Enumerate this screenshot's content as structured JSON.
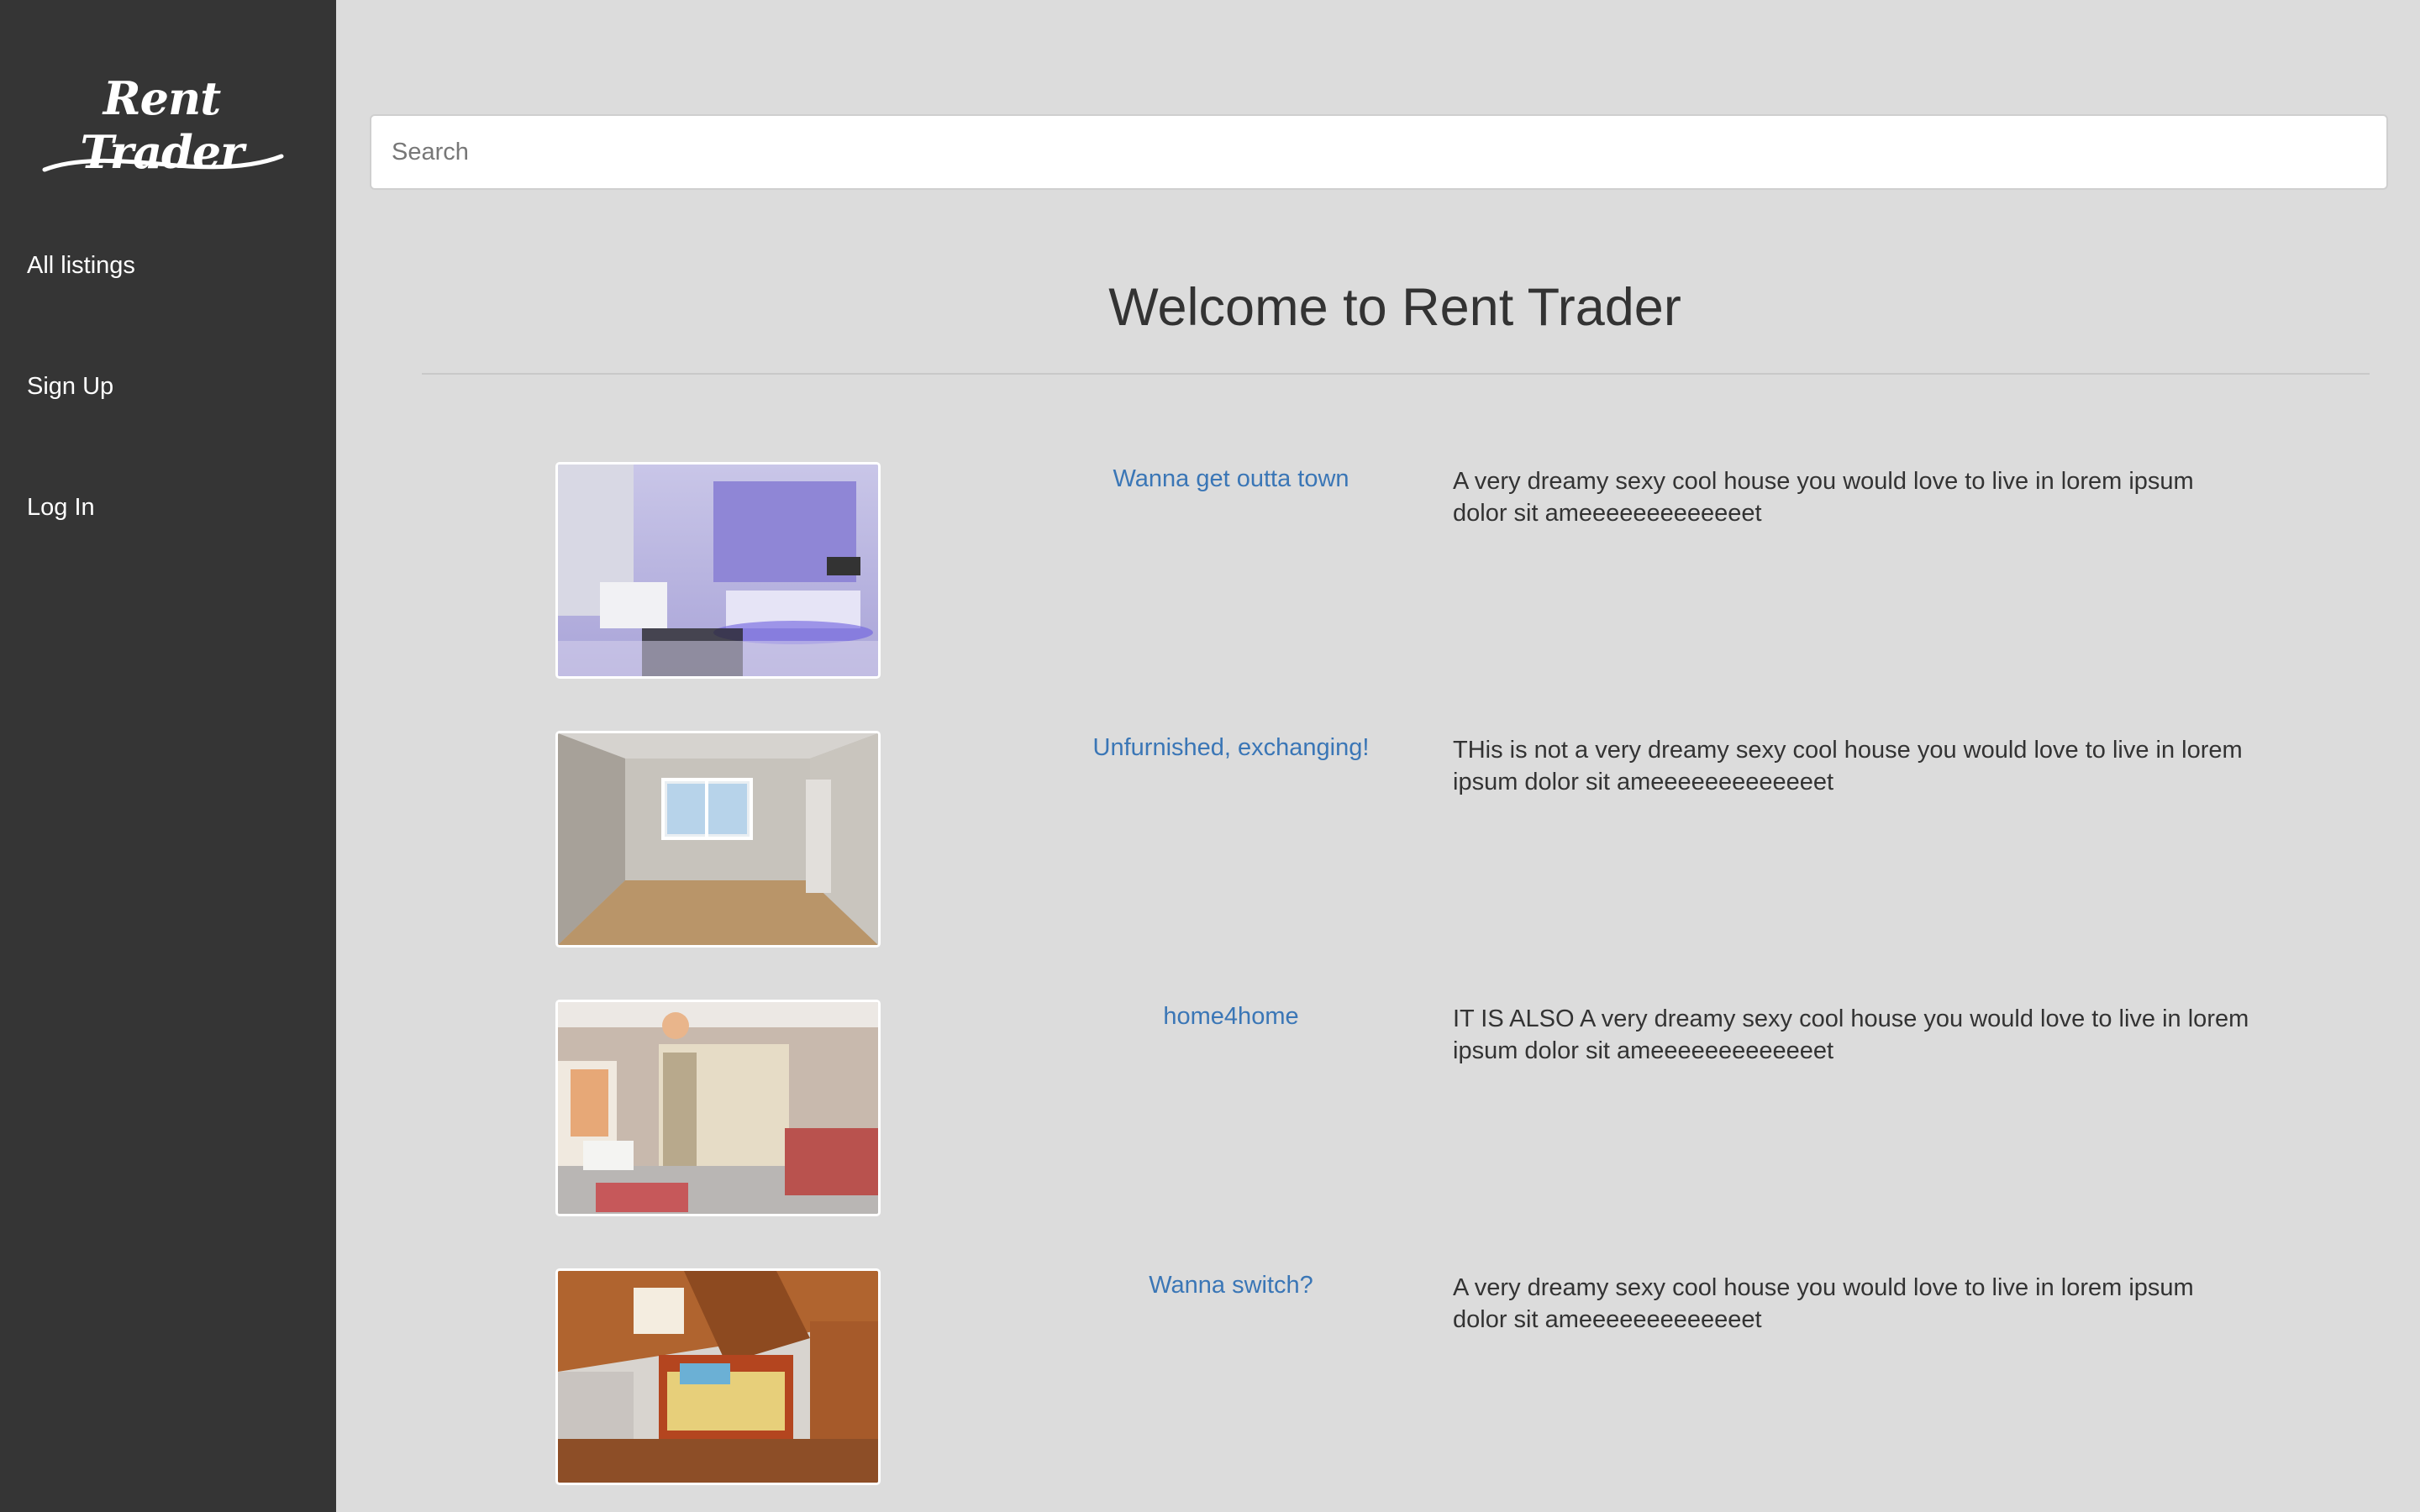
{
  "sidebar": {
    "logo_text": "Rent Trader",
    "nav": [
      {
        "label": "All listings"
      },
      {
        "label": "Sign Up"
      },
      {
        "label": "Log In"
      }
    ]
  },
  "search": {
    "placeholder": "Search",
    "value": ""
  },
  "main": {
    "title": "Welcome to Rent Trader"
  },
  "listings": [
    {
      "title": "Wanna get outta town",
      "description": "A very dreamy sexy cool house you would love to live in lorem ipsum dolor sit ameeeeeeeeeeeeet"
    },
    {
      "title": "Unfurnished, exchanging!",
      "description": "THis is not a very dreamy sexy cool house you would love to live in lorem ipsum dolor sit ameeeeeeeeeeeeet"
    },
    {
      "title": "home4home",
      "description": "IT IS ALSO A very dreamy sexy cool house you would love to live in lorem ipsum dolor sit ameeeeeeeeeeeeet"
    },
    {
      "title": "Wanna switch?",
      "description": "A very dreamy sexy cool house you would love to live in lorem ipsum dolor sit ameeeeeeeeeeeeet"
    }
  ],
  "colors": {
    "sidebar_bg": "#353535",
    "page_bg": "#dcdcdc",
    "link": "#3a76b6",
    "text": "#333333"
  }
}
